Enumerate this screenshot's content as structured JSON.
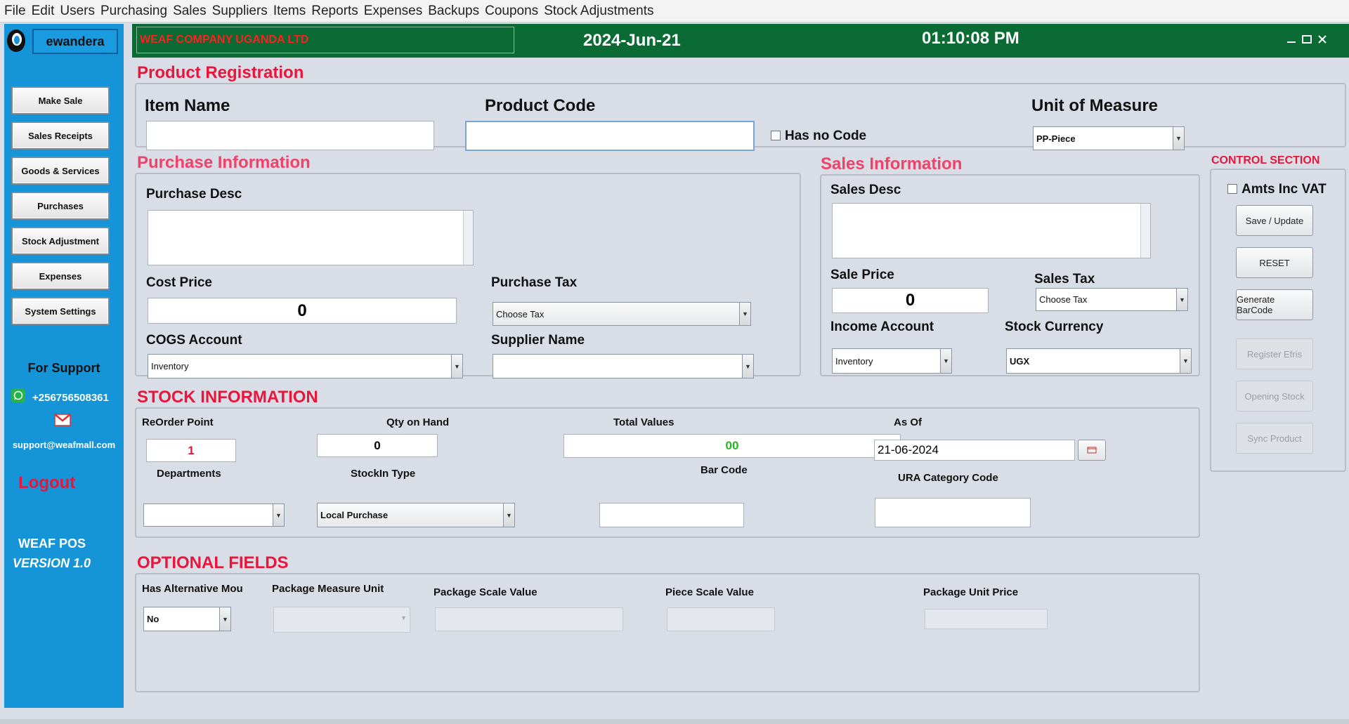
{
  "menu": [
    "File",
    "Edit",
    "Users",
    "Purchasing",
    "Sales",
    "Suppliers",
    "Items",
    "Reports",
    "Expenses",
    "Backups",
    "Coupons",
    "Stock Adjustments"
  ],
  "sidebar": {
    "username": "ewandera",
    "buttons": [
      "Make  Sale",
      "Sales Receipts",
      "Goods & Services",
      "Purchases",
      "Stock Adjustment",
      "Expenses",
      "System Settings"
    ],
    "support_title": "For Support",
    "phone": "+256756508361",
    "email": "support@weafmall.com",
    "logout": "Logout",
    "app_name": "WEAF POS",
    "version": "VERSION 1.0"
  },
  "header": {
    "company": "WEAF COMPANY UGANDA LTD",
    "date": "2024-Jun-21",
    "time": "01:10:08 PM"
  },
  "product_registration": {
    "title": "Product Registration",
    "item_name_label": "Item Name",
    "item_name_value": "",
    "product_code_label": "Product Code",
    "product_code_value": "",
    "has_no_code_label": "Has no Code",
    "uom_label": "Unit of Measure",
    "uom_value": "PP-Piece"
  },
  "purchase_info": {
    "title": "Purchase Information",
    "desc_label": "Purchase Desc",
    "cost_price_label": "Cost Price",
    "cost_price_value": "0",
    "purchase_tax_label": "Purchase Tax",
    "purchase_tax_value": "Choose Tax",
    "cogs_label": "COGS Account",
    "cogs_value": "Inventory",
    "supplier_label": "Supplier Name",
    "supplier_value": ""
  },
  "sales_info": {
    "title": "Sales Information",
    "desc_label": "Sales Desc",
    "sale_price_label": "Sale Price",
    "sale_price_value": "0",
    "sales_tax_label": "Sales Tax",
    "sales_tax_value": "Choose Tax",
    "income_label": "Income Account",
    "income_value": "Inventory",
    "currency_label": "Stock Currency",
    "currency_value": "UGX"
  },
  "control": {
    "title": "CONTROL SECTION",
    "amts_inc_vat": "Amts Inc VAT",
    "buttons": [
      "Save / Update",
      "RESET",
      "Generate BarCode",
      "Register Efris",
      "Opening Stock",
      "Sync Product"
    ]
  },
  "stock_info": {
    "title": "STOCK INFORMATION",
    "reorder_label": "ReOrder Point",
    "reorder_value": "1",
    "qty_label": "Qty on Hand",
    "qty_value": "0",
    "total_label": "Total Values",
    "total_value": "00",
    "asof_label": "As Of",
    "asof_value": "21-06-2024",
    "departments_label": "Departments",
    "departments_value": "",
    "stockin_label": "StockIn Type",
    "stockin_value": "Local Purchase",
    "barcode_label": "Bar Code",
    "ura_label": "URA Category Code"
  },
  "optional": {
    "title": "OPTIONAL FIELDS",
    "alt_mou_label": "Has Alternative Mou",
    "alt_mou_value": "No",
    "pkg_unit_label": "Package Measure Unit",
    "pkg_scale_label": "Package Scale Value",
    "piece_scale_label": "Piece Scale Value",
    "pkg_price_label": "Package Unit Price"
  },
  "colors": {
    "sidebar": "#1594d8",
    "header": "#0a6b34",
    "accent": "#e8163c"
  }
}
